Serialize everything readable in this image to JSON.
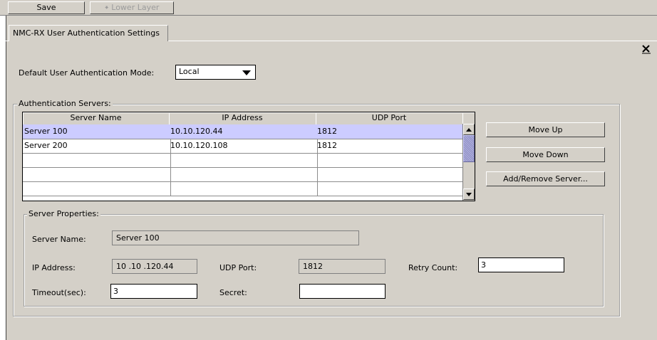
{
  "toolbar": {
    "save_label": "Save",
    "lower_layer_label": "Lower Layer"
  },
  "tab": {
    "label": "NMC-RX User Authentication Settings"
  },
  "auth_mode": {
    "label": "Default User Authentication Mode:",
    "selected": "Local"
  },
  "servers_group": {
    "legend": "Authentication Servers:"
  },
  "table": {
    "columns": [
      "Server Name",
      "IP Address",
      "UDP Port"
    ],
    "rows": [
      [
        "Server 100",
        "10.10.120.44",
        "1812"
      ],
      [
        "Server 200",
        "10.10.120.108",
        "1812"
      ],
      [
        "",
        "",
        ""
      ],
      [
        "",
        "",
        ""
      ],
      [
        "",
        "",
        ""
      ]
    ]
  },
  "buttons": {
    "move_up": "Move Up",
    "move_down": "Move Down",
    "add_remove": "Add/Remove Server..."
  },
  "props": {
    "legend": "Server Properties:",
    "server_name_label": "Server Name:",
    "server_name_value": "Server 100",
    "ip_label": "IP Address:",
    "ip_value": "10 .10 .120.44",
    "udp_label": "UDP Port:",
    "udp_value": "1812",
    "retry_label": "Retry Count:",
    "retry_value": "3",
    "timeout_label": "Timeout(sec):",
    "timeout_value": "3",
    "secret_label": "Secret:",
    "secret_value": ""
  },
  "colors": {
    "panel_bg": "#d4d0c8",
    "selection": "#ccccff",
    "scroll_thumb": "#9999cc"
  },
  "icons": {
    "lower_layer": "down-arrow-icon",
    "close": "close-icon",
    "dropdown": "chevron-down-icon"
  }
}
